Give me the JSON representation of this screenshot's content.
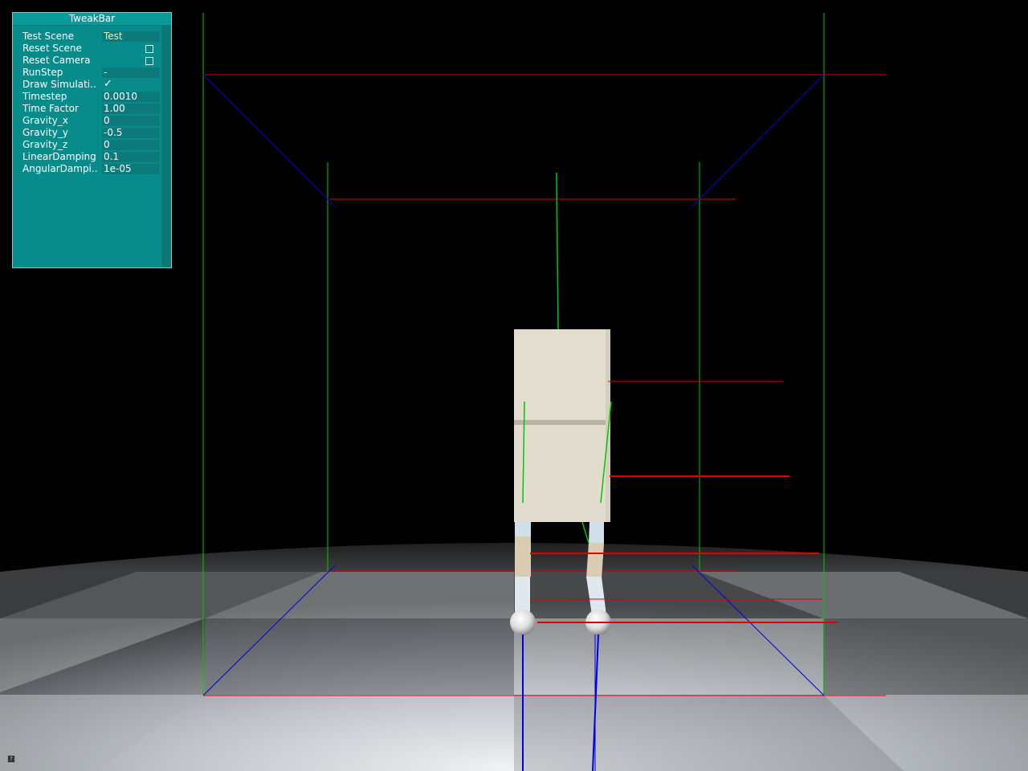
{
  "tweakbar": {
    "title": "TweakBar",
    "rows": [
      {
        "label": "Test Scene",
        "value": "Test",
        "kind": "enum"
      },
      {
        "label": "Reset Scene",
        "value": "",
        "kind": "button"
      },
      {
        "label": "Reset Camera",
        "value": "",
        "kind": "button"
      },
      {
        "label": "RunStep",
        "value": "-",
        "kind": "text"
      },
      {
        "label": "Draw Simulati..",
        "value": "",
        "kind": "bool_checked"
      },
      {
        "label": "Timestep",
        "value": "0.0010",
        "kind": "number"
      },
      {
        "label": "Time Factor",
        "value": "1.00",
        "kind": "number"
      },
      {
        "label": "Gravity_x",
        "value": "0",
        "kind": "number"
      },
      {
        "label": "Gravity_y",
        "value": "-0.5",
        "kind": "number"
      },
      {
        "label": "Gravity_z",
        "value": "0",
        "kind": "number"
      },
      {
        "label": "LinearDamping",
        "value": "0.1",
        "kind": "number"
      },
      {
        "label": "AngularDampi..",
        "value": "1e-05",
        "kind": "number"
      }
    ]
  },
  "colors": {
    "panel": "#078b8b",
    "axis_x": "#e00000",
    "axis_y": "#00c800",
    "axis_z": "#0000e0"
  },
  "icons": {
    "checkmark": "✓",
    "corner": "?"
  }
}
